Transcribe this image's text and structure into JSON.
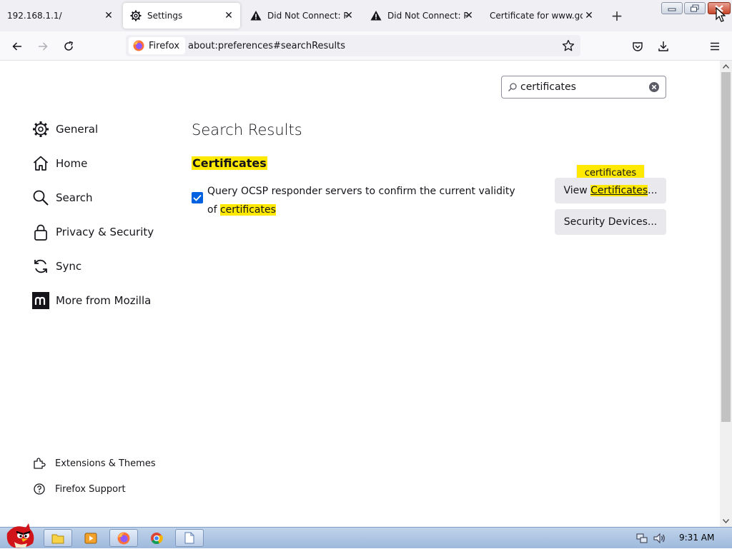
{
  "tabs": [
    {
      "title": "192.168.1.1/",
      "icon": "none",
      "active": false
    },
    {
      "title": "Settings",
      "icon": "gear-icon",
      "active": true
    },
    {
      "title": "Did Not Connect: Pot",
      "icon": "warning-icon",
      "active": false
    },
    {
      "title": "Did Not Connect: Pot",
      "icon": "warning-icon",
      "active": false
    },
    {
      "title": "Certificate for www.goog",
      "icon": "none",
      "active": false
    }
  ],
  "new_tab_label": "+",
  "toolbar": {
    "identity_label": "Firefox",
    "url": "about:preferences#searchResults"
  },
  "search": {
    "value": "certificates"
  },
  "sidebar": {
    "items": [
      {
        "label": "General",
        "icon": "gear-icon"
      },
      {
        "label": "Home",
        "icon": "home-icon"
      },
      {
        "label": "Search",
        "icon": "search-icon"
      },
      {
        "label": "Privacy & Security",
        "icon": "lock-icon"
      },
      {
        "label": "Sync",
        "icon": "sync-icon"
      },
      {
        "label": "More from Mozilla",
        "icon": "mozilla-icon"
      }
    ],
    "footer": [
      {
        "label": "Extensions & Themes",
        "icon": "puzzle-icon"
      },
      {
        "label": "Firefox Support",
        "icon": "help-icon"
      }
    ]
  },
  "main": {
    "heading": "Search Results",
    "group_title": "Certificates",
    "ocsp": {
      "label_prefix": "Query OCSP responder servers to confirm the current validity of",
      "label_highlight": "certificates",
      "checked": true
    },
    "tooltip": "certificates",
    "buttons": {
      "view_prefix": "View ",
      "view_highlight": "Certificates",
      "view_suffix": "...",
      "security_devices": "Security Devices..."
    }
  },
  "taskbar": {
    "clock": "9:31 AM"
  },
  "colors": {
    "accent": "#0061e0",
    "highlight": "#ffe900",
    "tabstrip": "#f0f0f4"
  }
}
